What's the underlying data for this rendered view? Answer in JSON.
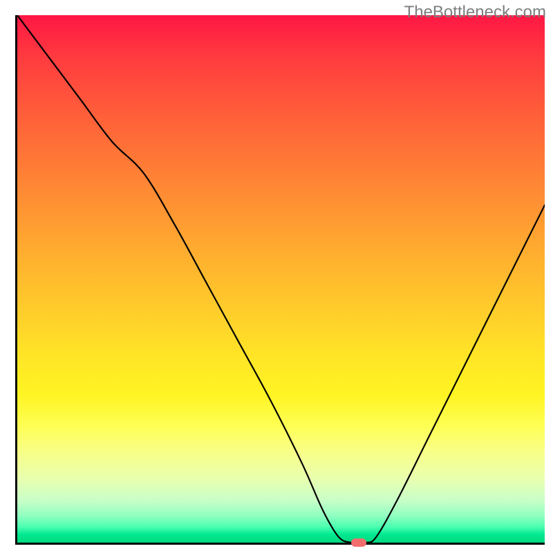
{
  "watermark": "TheBottleneck.com",
  "chart_data": {
    "type": "line",
    "title": "",
    "xlabel": "",
    "ylabel": "",
    "xlim": [
      0,
      100
    ],
    "ylim": [
      0,
      100
    ],
    "grid": false,
    "legend": false,
    "gradient": {
      "top_color": "#ff1744",
      "mid_color": "#ffd22a",
      "bottom_color": "#00d980"
    },
    "series": [
      {
        "name": "bottleneck-curve",
        "x": [
          0,
          6,
          12,
          18,
          24,
          30,
          36,
          42,
          48,
          54,
          58,
          61,
          63.5,
          66,
          68,
          72,
          78,
          84,
          90,
          96,
          100
        ],
        "y": [
          100,
          92,
          84,
          76,
          70,
          60,
          49,
          38,
          27,
          15,
          6,
          1,
          0,
          0,
          1,
          8,
          20,
          32,
          44,
          56,
          64
        ]
      }
    ],
    "marker": {
      "x": 64.5,
      "y": 0,
      "color": "#f26d6d"
    }
  }
}
